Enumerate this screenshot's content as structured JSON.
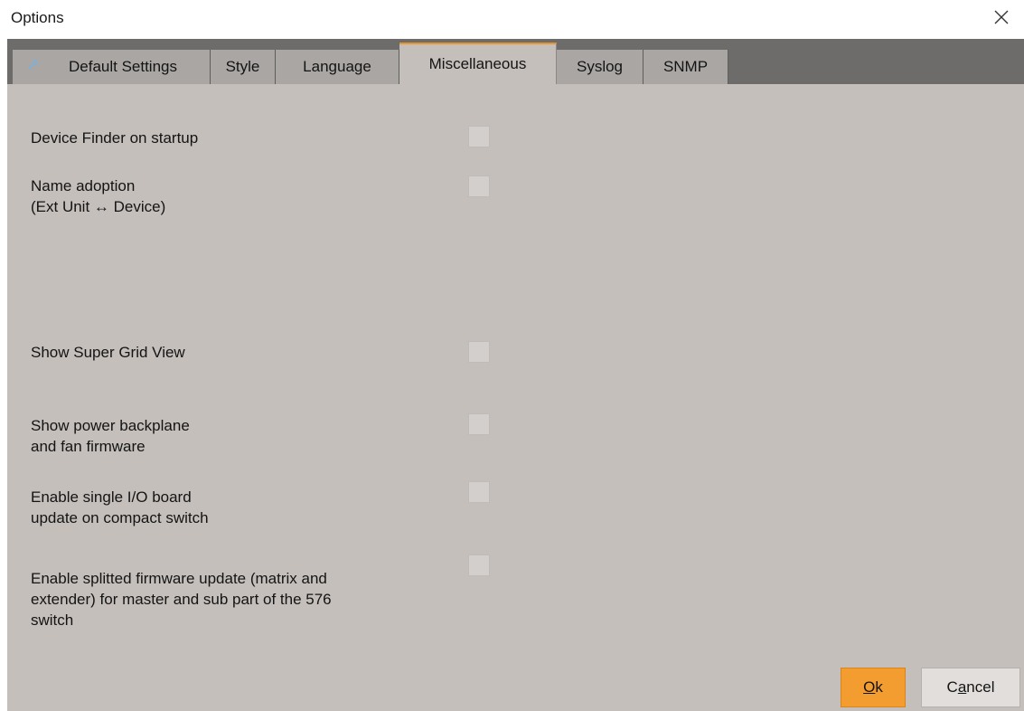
{
  "window": {
    "title": "Options"
  },
  "tabs": [
    {
      "label": "Default Settings",
      "icon": "settings-icon",
      "active": false
    },
    {
      "label": "Style",
      "active": false
    },
    {
      "label": "Language",
      "active": false
    },
    {
      "label": "Miscellaneous",
      "active": true
    },
    {
      "label": "Syslog",
      "active": false
    },
    {
      "label": "SNMP",
      "active": false
    }
  ],
  "options": [
    {
      "label": "Device Finder on startup",
      "checked": false
    },
    {
      "label": "Name adoption\n(Ext Unit ↔ Device)",
      "checked": false
    },
    {
      "label": "Show Super Grid View",
      "checked": false
    },
    {
      "label": "Show power backplane\nand fan firmware",
      "checked": false
    },
    {
      "label": "Enable single I/O board\nupdate on compact switch",
      "checked": false
    },
    {
      "label": "Enable splitted firmware update (matrix and\nextender) for master and sub part of the 576\nswitch",
      "checked": false
    }
  ],
  "buttons": {
    "ok": {
      "mnemonic": "O",
      "rest": "k"
    },
    "cancel": {
      "pre": "C",
      "mnemonic": "a",
      "rest": "ncel"
    }
  },
  "colors": {
    "accent": "#f39c2f",
    "panel": "#c4bfbb",
    "tabbar": "#6e6c6a"
  }
}
